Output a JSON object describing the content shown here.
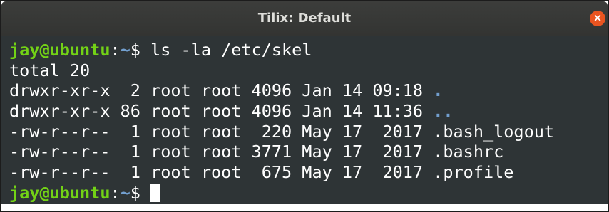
{
  "window": {
    "title": "Tilix: Default",
    "close_glyph": "×"
  },
  "terminal": {
    "prompt": {
      "user_host": "jay@ubuntu",
      "colon": ":",
      "cwd": "~",
      "symbol": "$ "
    },
    "command": "ls -la /etc/skel",
    "total_line": "total 20",
    "entries": [
      {
        "meta": "drwxr-xr-x  2 root root 4096 Jan 14 09:18 ",
        "name": "."
      },
      {
        "meta": "drwxr-xr-x 86 root root 4096 Jan 14 11:36 ",
        "name": ".."
      },
      {
        "meta": "-rw-r--r--  1 root root  220 May 17  2017 ",
        "name": ".bash_logout"
      },
      {
        "meta": "-rw-r--r--  1 root root 3771 May 17  2017 ",
        "name": ".bashrc"
      },
      {
        "meta": "-rw-r--r--  1 root root  675 May 17  2017 ",
        "name": ".profile"
      }
    ]
  },
  "colors": {
    "terminal_bg": "#2e3436",
    "prompt_user": "#73d216",
    "prompt_path": "#729fcf",
    "directory": "#729fcf",
    "close_button": "#e95420"
  }
}
